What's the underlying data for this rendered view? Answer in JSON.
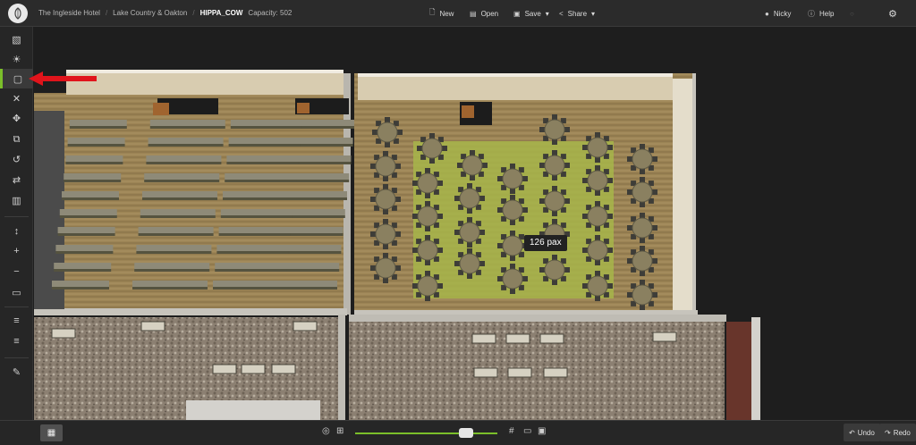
{
  "breadcrumb": {
    "venue": "The Ingleside Hotel",
    "room": "Lake Country & Oakton",
    "layout": "HIPPA_COW",
    "capacity": "Capacity: 502"
  },
  "toolbar": {
    "new_label": "New",
    "open_label": "Open",
    "save_label": "Save",
    "share_label": "Share",
    "user_label": "Nicky",
    "help_label": "Help"
  },
  "canvas": {
    "pax_label": "126 pax"
  },
  "bottom": {
    "undo_label": "Undo",
    "redo_label": "Redo",
    "zoom_level": 0.78
  },
  "colors": {
    "accent": "#7bbf2a",
    "arrow": "#e0141b",
    "floor_wood": "#9c8455",
    "floor_carpet_stone": "#8c8072",
    "highlight_area": "#a7b54a"
  },
  "icons": {
    "sidebar": [
      "cube-icon",
      "sun-icon",
      "select-frame-icon",
      "close-icon",
      "move-icon",
      "copy-icon",
      "rotate-icon",
      "swap-icon",
      "trash-icon",
      "height-icon",
      "plus-icon",
      "minus-icon",
      "ruler-icon",
      "align-top-icon",
      "align-bottom-icon",
      "edit-icon"
    ]
  }
}
